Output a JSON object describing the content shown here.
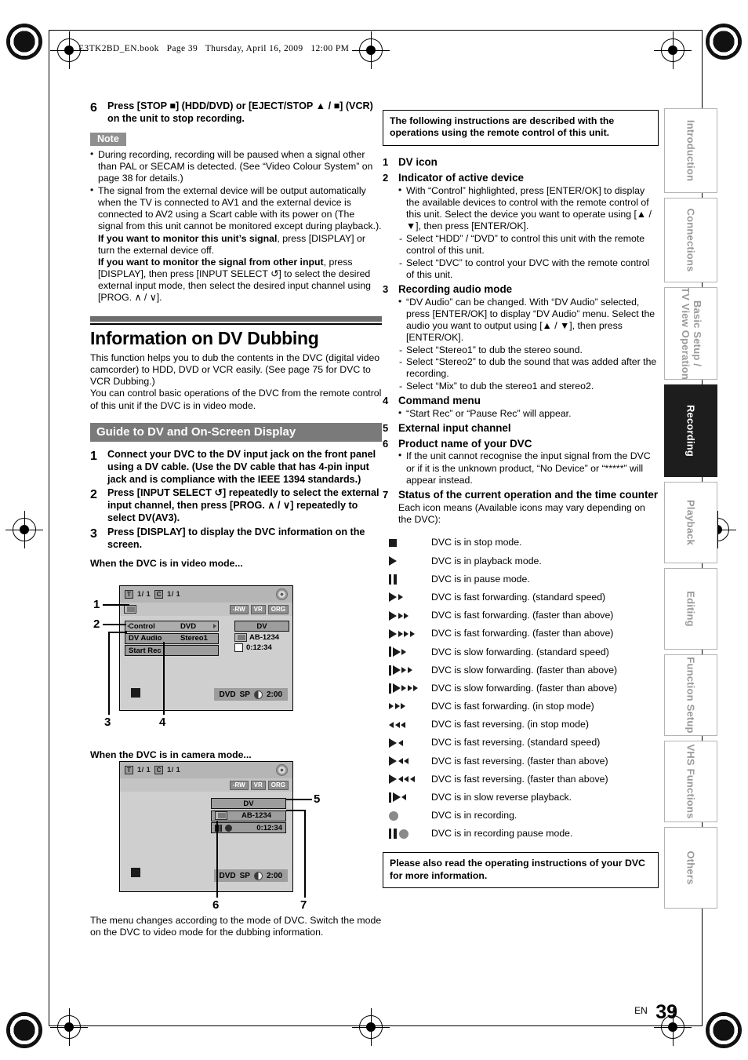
{
  "header": {
    "filename_line": "E3TK2BD_EN.book   Page 39   Thursday, April 16, 2009   12:00 PM"
  },
  "left_column": {
    "step6": {
      "number": "6",
      "text": "Press [STOP ■] (HDD/DVD) or [EJECT/STOP ▲ / ■] (VCR) on the unit to stop recording."
    },
    "note_tag": "Note",
    "note_bullets": [
      "During recording, recording will be paused when a signal other than PAL or SECAM is detected. (See “Video Colour System” on page 38 for details.)",
      "The signal from the external device will be output automatically when the TV is connected to AV1 and the external device is connected to AV2 using a Scart cable with its power on (The signal from this unit cannot be monitored except during playback.)."
    ],
    "note_bold_lines": [
      {
        "bold": "If you want to monitor this unit’s signal",
        "rest": ", press [DISPLAY] or turn the external device off."
      },
      {
        "bold": "If you want to monitor the signal from other input",
        "rest": ", press [DISPLAY], then press [INPUT SELECT ↺] to select the desired external input mode, then select the desired input channel using [PROG. ∧ / ∨]."
      }
    ],
    "section_title": "Information on DV Dubbing",
    "section_intro": [
      "This function helps you to dub the contents in the DVC (digital video camcorder) to HDD, DVD or VCR easily. (See page 75 for DVC to VCR Dubbing.)",
      "You can control basic operations of the DVC from the remote control of this unit if the DVC is in video mode."
    ],
    "bar_heading": "Guide to DV and On-Screen Display",
    "steps": [
      {
        "number": "1",
        "text": "Connect your DVC to the DV input jack on the front panel using a DV cable. (Use the DV cable that has 4-pin input jack and is compliance with the IEEE 1394 standards.)"
      },
      {
        "number": "2",
        "text": "Press [INPUT SELECT ↺] repeatedly to select the external input channel, then press [PROG. ∧ / ∨] repeatedly to select DV(AV3)."
      },
      {
        "number": "3",
        "text": "Press [DISPLAY] to display the DVC information on the screen."
      }
    ],
    "caption_video": "When the DVC is in video mode...",
    "caption_camera": "When the DVC is in camera mode...",
    "closing_text": "The menu changes according to the mode of DVC. Switch the mode on the DVC to video mode for the dubbing information."
  },
  "screen_video_mode": {
    "title_index": "1/ 1",
    "chapter_index": "1/ 1",
    "title_letter": "T",
    "chapter_letter": "C",
    "chips": [
      "-RW",
      "VR",
      "ORG"
    ],
    "menu_rows": [
      {
        "key": "Control",
        "value": "DVD"
      },
      {
        "key": "DV Audio",
        "value": "Stereo1"
      },
      {
        "key": "Start Rec",
        "value": ""
      }
    ],
    "dv_label": "DV",
    "dv_product": "AB-1234",
    "dv_time": "0:12:34",
    "status_media": "DVD",
    "status_mode": "SP",
    "status_time": "2:00",
    "callouts": [
      "1",
      "2",
      "3",
      "4"
    ]
  },
  "screen_camera_mode": {
    "title_index": "1/ 1",
    "chapter_index": "1/ 1",
    "title_letter": "T",
    "chapter_letter": "C",
    "chips": [
      "-RW",
      "VR",
      "ORG"
    ],
    "dv_label": "DV",
    "dv_product": "AB-1234",
    "dv_time": "0:12:34",
    "status_media": "DVD",
    "status_mode": "SP",
    "status_time": "2:00",
    "callouts": [
      "5",
      "6",
      "7"
    ]
  },
  "right_column": {
    "top_note": "The following instructions are described with the operations using the remote control of this unit.",
    "items": [
      {
        "number": "1",
        "title": "DV icon"
      },
      {
        "number": "2",
        "title": "Indicator of active device"
      },
      {
        "number": "3",
        "title": "Recording audio mode"
      },
      {
        "number": "4",
        "title": "Command menu"
      },
      {
        "number": "5",
        "title": "External input channel"
      },
      {
        "number": "6",
        "title": "Product name of your DVC"
      },
      {
        "number": "7",
        "title": "Status of the current operation and the time counter"
      }
    ],
    "item2_bullet": "With “Control” highlighted, press [ENTER/OK] to display the available devices to control with the remote control of this unit. Select the device you want to operate using [▲ / ▼], then press [ENTER/OK].",
    "item2_dashes": [
      "Select “HDD” / “DVD” to control this unit with the remote control of this unit.",
      "Select “DVC” to control your DVC with the remote control of this unit."
    ],
    "item3_bullet": "“DV Audio” can be changed. With “DV Audio” selected, press [ENTER/OK] to display “DV Audio” menu. Select the audio you want to output using [▲ / ▼], then press [ENTER/OK].",
    "item3_dashes": [
      "Select “Stereo1” to dub the stereo sound.",
      "Select “Stereo2” to dub the sound that was added after the recording.",
      "Select “Mix” to dub the stereo1 and stereo2."
    ],
    "item4_bullet": "“Start Rec” or “Pause Rec” will appear.",
    "item6_bullet": "If the unit cannot recognise the input signal from the DVC or if it is the unknown product, “No Device” or “*****” will appear instead.",
    "item7_intro": "Each icon means (Available icons may vary depending on the DVC):",
    "icon_legend": [
      {
        "icon": "stop-icon",
        "label": "DVC is in stop mode."
      },
      {
        "icon": "play-icon",
        "label": "DVC is in playback mode."
      },
      {
        "icon": "pause-icon",
        "label": "DVC is in pause mode."
      },
      {
        "icon": "fast-forward-1-icon",
        "label": "DVC is fast forwarding. (standard speed)"
      },
      {
        "icon": "fast-forward-2-icon",
        "label": "DVC is fast forwarding. (faster than above)"
      },
      {
        "icon": "fast-forward-3-icon",
        "label": "DVC is fast forwarding. (faster than above)"
      },
      {
        "icon": "slow-forward-1-icon",
        "label": "DVC is slow forwarding. (standard speed)"
      },
      {
        "icon": "slow-forward-2-icon",
        "label": "DVC is slow forwarding. (faster than above)"
      },
      {
        "icon": "slow-forward-3-icon",
        "label": "DVC is slow forwarding. (faster than above)"
      },
      {
        "icon": "fast-forward-stop-mode-icon",
        "label": "DVC is fast forwarding. (in stop mode)"
      },
      {
        "icon": "fast-reverse-stop-mode-icon",
        "label": "DVC is fast reversing. (in stop mode)"
      },
      {
        "icon": "fast-reverse-1-icon",
        "label": "DVC is fast reversing. (standard speed)"
      },
      {
        "icon": "fast-reverse-2-icon",
        "label": "DVC is fast reversing. (faster than above)"
      },
      {
        "icon": "fast-reverse-3-icon",
        "label": "DVC is fast reversing. (faster than above)"
      },
      {
        "icon": "slow-reverse-icon",
        "label": "DVC is in slow reverse playback."
      },
      {
        "icon": "record-icon",
        "label": "DVC is in recording."
      },
      {
        "icon": "record-pause-icon",
        "label": "DVC is in recording pause mode."
      }
    ],
    "bottom_note": "Please also read the operating instructions of your DVC for more information."
  },
  "side_tabs": [
    {
      "label": "Introduction",
      "active": false
    },
    {
      "label": "Connections",
      "active": false
    },
    {
      "label": "Basic Setup /\nTV View Operation",
      "active": false
    },
    {
      "label": "Recording",
      "active": true
    },
    {
      "label": "Playback",
      "active": false
    },
    {
      "label": "Editing",
      "active": false
    },
    {
      "label": "Function Setup",
      "active": false
    },
    {
      "label": "VHS Functions",
      "active": false
    },
    {
      "label": "Others",
      "active": false
    }
  ],
  "footer": {
    "lang": "EN",
    "page": "39"
  }
}
